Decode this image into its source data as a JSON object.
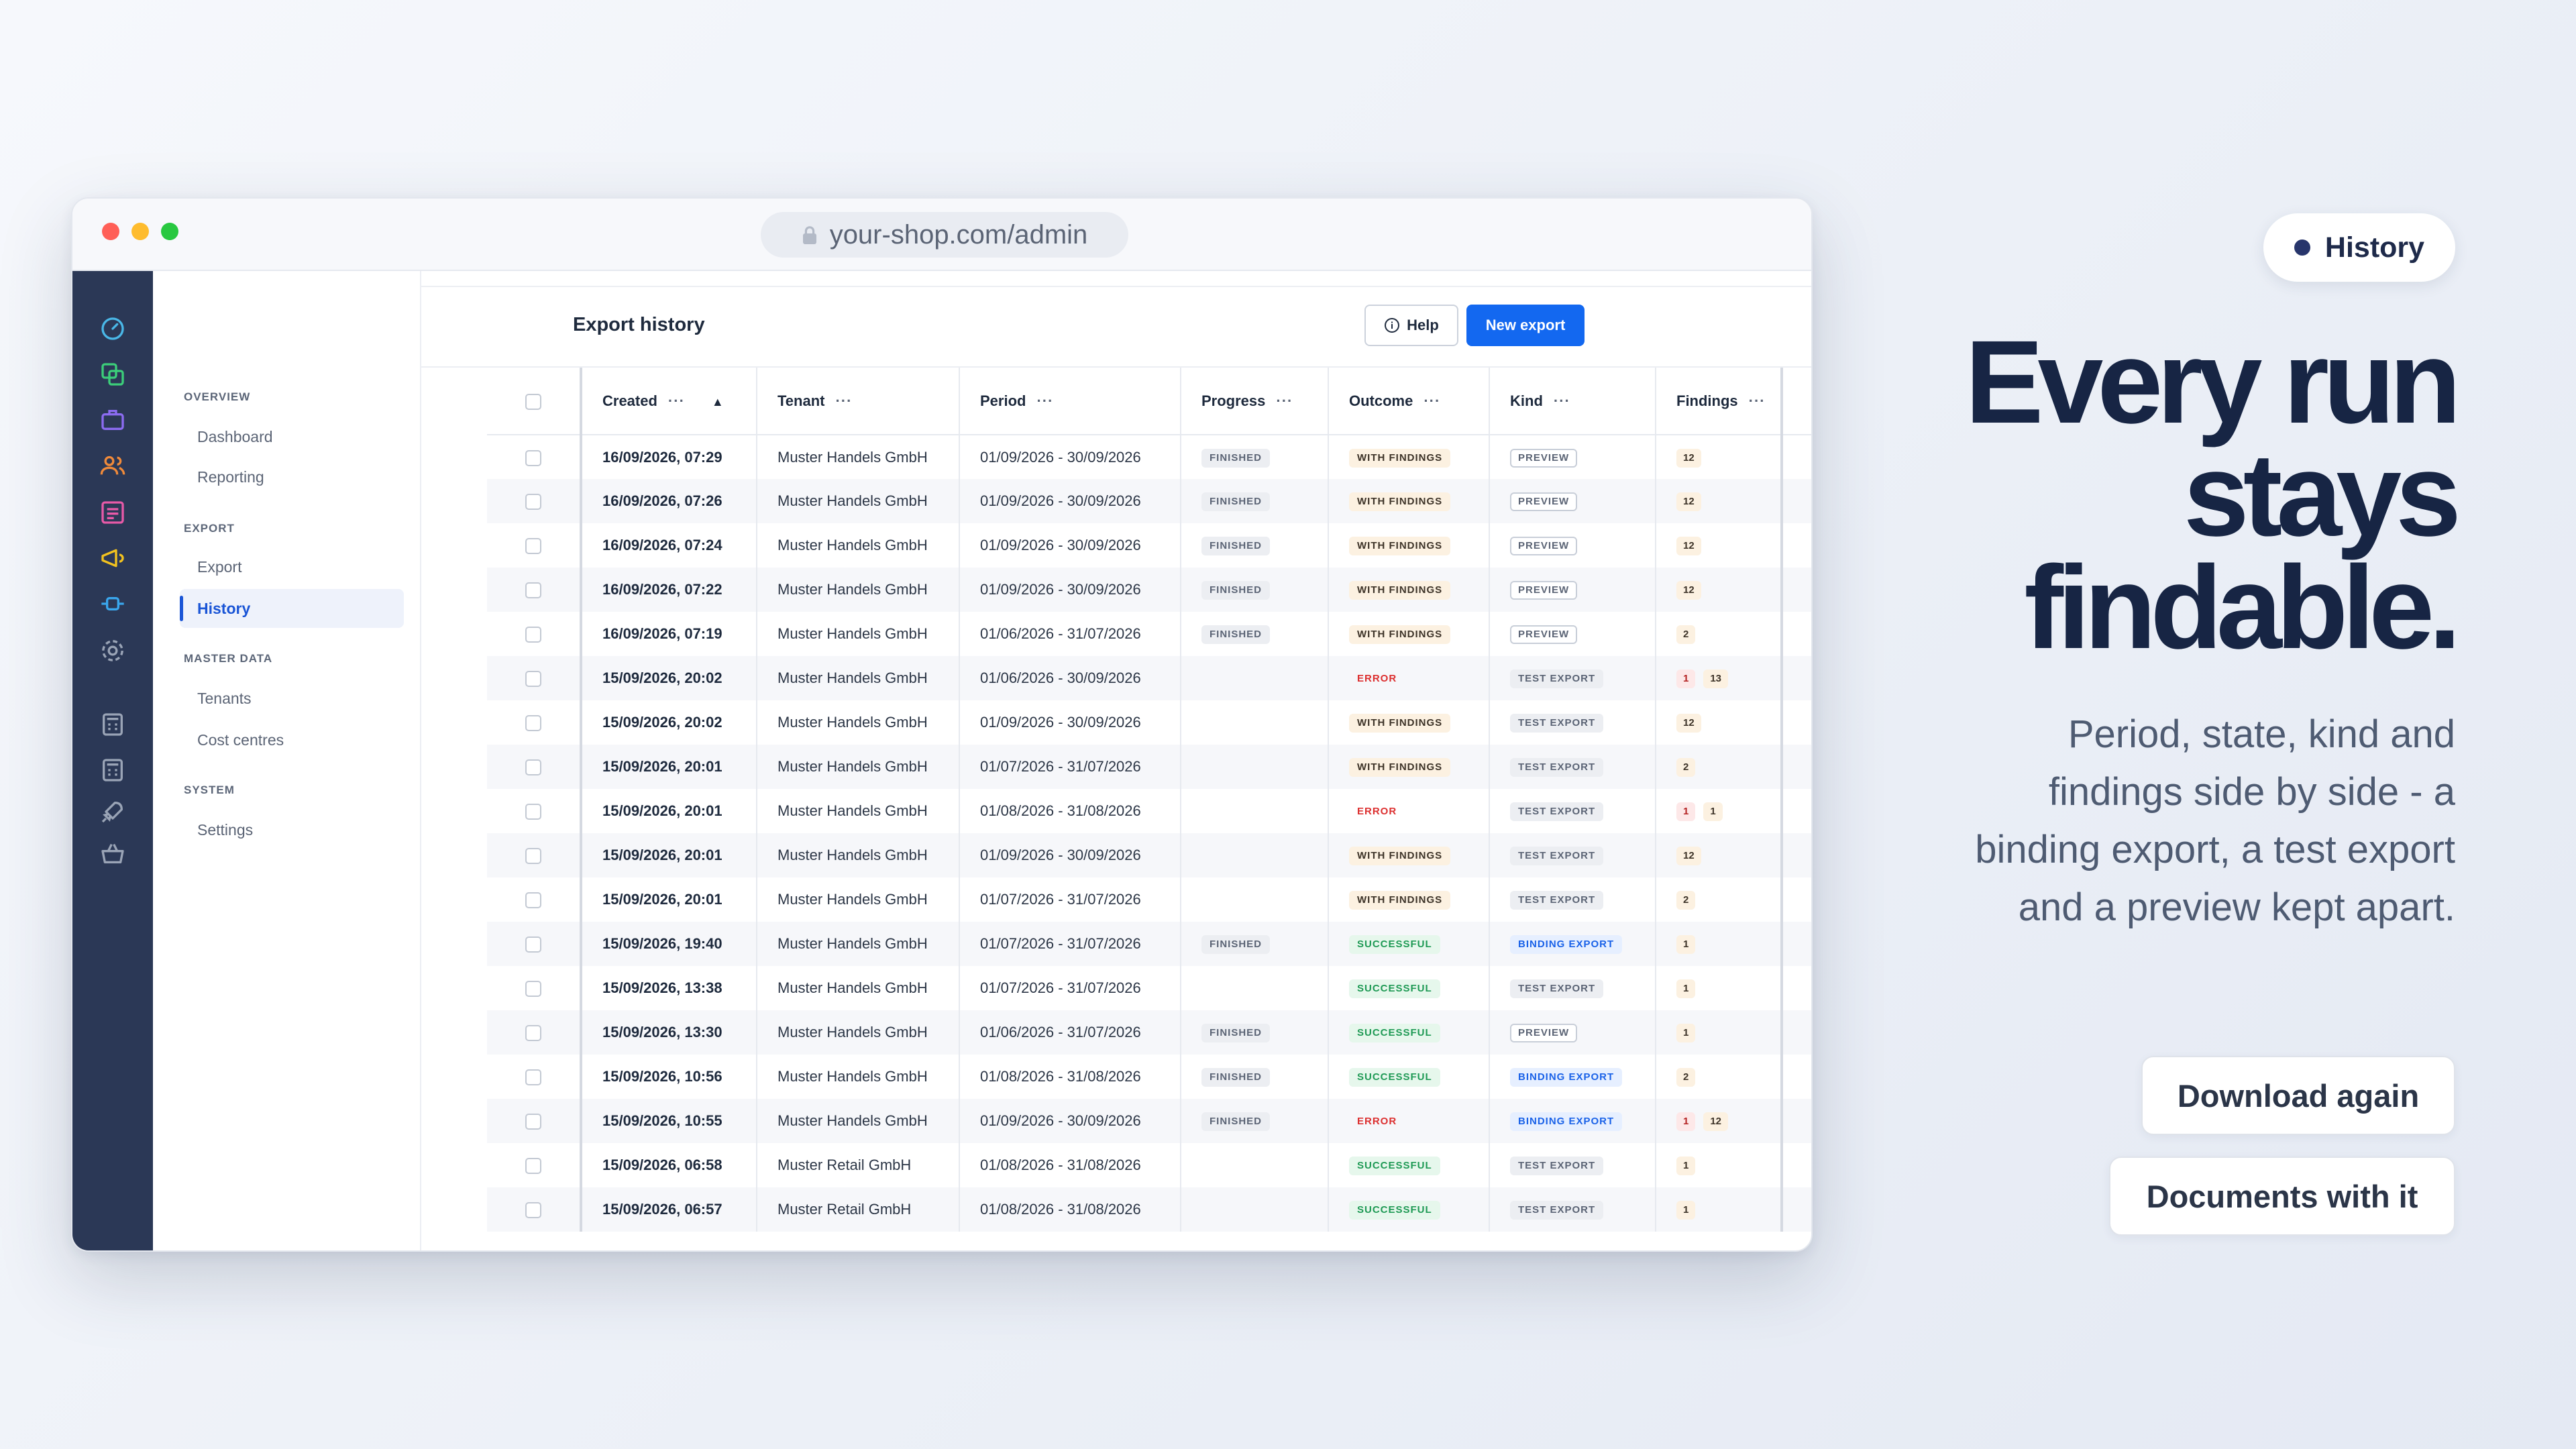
{
  "browser": {
    "url": "your-shop.com/admin"
  },
  "nav": {
    "sections": [
      {
        "title": "OVERVIEW",
        "items": [
          "Dashboard",
          "Reporting"
        ]
      },
      {
        "title": "EXPORT",
        "items": [
          "Export",
          "History"
        ]
      },
      {
        "title": "MASTER DATA",
        "items": [
          "Tenants",
          "Cost centres"
        ]
      },
      {
        "title": "SYSTEM",
        "items": [
          "Settings"
        ]
      }
    ],
    "active_item": "History"
  },
  "rail": {
    "icons": [
      {
        "name": "gauge-icon",
        "color": "#4ab8e8"
      },
      {
        "name": "copy-icon",
        "color": "#3ccf7a"
      },
      {
        "name": "briefcase-icon",
        "color": "#8c6cf2"
      },
      {
        "name": "users-icon",
        "color": "#f08a3a"
      },
      {
        "name": "list-icon",
        "color": "#e85aa8"
      },
      {
        "name": "megaphone-icon",
        "color": "#f2c21f"
      },
      {
        "name": "plug-icon",
        "color": "#3aa7ee"
      },
      {
        "name": "gear-icon",
        "color": "#9aa4b6"
      },
      {
        "name": "calculator-icon",
        "color": "#9aa4b6"
      },
      {
        "name": "calculator-icon",
        "color": "#9aa4b6"
      },
      {
        "name": "rocket-icon",
        "color": "#9aa4b6"
      },
      {
        "name": "basket-icon",
        "color": "#9aa4b6"
      }
    ]
  },
  "header": {
    "title": "Export history",
    "help_label": "Help",
    "new_export_label": "New export"
  },
  "table": {
    "columns": [
      "Created",
      "Tenant",
      "Period",
      "Progress",
      "Outcome",
      "Kind",
      "Findings"
    ],
    "col_menu": "···",
    "sort_indicator": "▲",
    "row_menu": "···",
    "rows": [
      {
        "created": "16/09/2026, 07:29",
        "tenant": "Muster Handels GmbH",
        "period": "01/09/2026 - 30/09/2026",
        "progress": "FINISHED",
        "outcome": "WITH FINDINGS",
        "kind": "PREVIEW",
        "findings": [
          {
            "v": "12",
            "t": "warn"
          }
        ]
      },
      {
        "created": "16/09/2026, 07:26",
        "tenant": "Muster Handels GmbH",
        "period": "01/09/2026 - 30/09/2026",
        "progress": "FINISHED",
        "outcome": "WITH FINDINGS",
        "kind": "PREVIEW",
        "findings": [
          {
            "v": "12",
            "t": "warn"
          }
        ]
      },
      {
        "created": "16/09/2026, 07:24",
        "tenant": "Muster Handels GmbH",
        "period": "01/09/2026 - 30/09/2026",
        "progress": "FINISHED",
        "outcome": "WITH FINDINGS",
        "kind": "PREVIEW",
        "findings": [
          {
            "v": "12",
            "t": "warn"
          }
        ]
      },
      {
        "created": "16/09/2026, 07:22",
        "tenant": "Muster Handels GmbH",
        "period": "01/09/2026 - 30/09/2026",
        "progress": "FINISHED",
        "outcome": "WITH FINDINGS",
        "kind": "PREVIEW",
        "findings": [
          {
            "v": "12",
            "t": "warn"
          }
        ]
      },
      {
        "created": "16/09/2026, 07:19",
        "tenant": "Muster Handels GmbH",
        "period": "01/06/2026 - 31/07/2026",
        "progress": "FINISHED",
        "outcome": "WITH FINDINGS",
        "kind": "PREVIEW",
        "findings": [
          {
            "v": "2",
            "t": "warn"
          }
        ]
      },
      {
        "created": "15/09/2026, 20:02",
        "tenant": "Muster Handels GmbH",
        "period": "01/06/2026 - 30/09/2026",
        "progress": "",
        "outcome": "ERROR",
        "kind": "TEST EXPORT",
        "findings": [
          {
            "v": "1",
            "t": "err"
          },
          {
            "v": "13",
            "t": "warn"
          }
        ]
      },
      {
        "created": "15/09/2026, 20:02",
        "tenant": "Muster Handels GmbH",
        "period": "01/09/2026 - 30/09/2026",
        "progress": "",
        "outcome": "WITH FINDINGS",
        "kind": "TEST EXPORT",
        "findings": [
          {
            "v": "12",
            "t": "warn"
          }
        ]
      },
      {
        "created": "15/09/2026, 20:01",
        "tenant": "Muster Handels GmbH",
        "period": "01/07/2026 - 31/07/2026",
        "progress": "",
        "outcome": "WITH FINDINGS",
        "kind": "TEST EXPORT",
        "findings": [
          {
            "v": "2",
            "t": "warn"
          }
        ]
      },
      {
        "created": "15/09/2026, 20:01",
        "tenant": "Muster Handels GmbH",
        "period": "01/08/2026 - 31/08/2026",
        "progress": "",
        "outcome": "ERROR",
        "kind": "TEST EXPORT",
        "findings": [
          {
            "v": "1",
            "t": "err"
          },
          {
            "v": "1",
            "t": "warn"
          }
        ]
      },
      {
        "created": "15/09/2026, 20:01",
        "tenant": "Muster Handels GmbH",
        "period": "01/09/2026 - 30/09/2026",
        "progress": "",
        "outcome": "WITH FINDINGS",
        "kind": "TEST EXPORT",
        "findings": [
          {
            "v": "12",
            "t": "warn"
          }
        ]
      },
      {
        "created": "15/09/2026, 20:01",
        "tenant": "Muster Handels GmbH",
        "period": "01/07/2026 - 31/07/2026",
        "progress": "",
        "outcome": "WITH FINDINGS",
        "kind": "TEST EXPORT",
        "findings": [
          {
            "v": "2",
            "t": "warn"
          }
        ]
      },
      {
        "created": "15/09/2026, 19:40",
        "tenant": "Muster Handels GmbH",
        "period": "01/07/2026 - 31/07/2026",
        "progress": "FINISHED",
        "outcome": "SUCCESSFUL",
        "kind": "BINDING EXPORT",
        "findings": [
          {
            "v": "1",
            "t": "warn"
          }
        ]
      },
      {
        "created": "15/09/2026, 13:38",
        "tenant": "Muster Handels GmbH",
        "period": "01/07/2026 - 31/07/2026",
        "progress": "",
        "outcome": "SUCCESSFUL",
        "kind": "TEST EXPORT",
        "findings": [
          {
            "v": "1",
            "t": "warn"
          }
        ]
      },
      {
        "created": "15/09/2026, 13:30",
        "tenant": "Muster Handels GmbH",
        "period": "01/06/2026 - 31/07/2026",
        "progress": "FINISHED",
        "outcome": "SUCCESSFUL",
        "kind": "PREVIEW",
        "findings": [
          {
            "v": "1",
            "t": "warn"
          }
        ]
      },
      {
        "created": "15/09/2026, 10:56",
        "tenant": "Muster Handels GmbH",
        "period": "01/08/2026 - 31/08/2026",
        "progress": "FINISHED",
        "outcome": "SUCCESSFUL",
        "kind": "BINDING EXPORT",
        "findings": [
          {
            "v": "2",
            "t": "warn"
          }
        ]
      },
      {
        "created": "15/09/2026, 10:55",
        "tenant": "Muster Handels GmbH",
        "period": "01/09/2026 - 30/09/2026",
        "progress": "FINISHED",
        "outcome": "ERROR",
        "kind": "BINDING EXPORT",
        "findings": [
          {
            "v": "1",
            "t": "err"
          },
          {
            "v": "12",
            "t": "warn"
          }
        ]
      },
      {
        "created": "15/09/2026, 06:58",
        "tenant": "Muster Retail GmbH",
        "period": "01/08/2026 - 31/08/2026",
        "progress": "",
        "outcome": "SUCCESSFUL",
        "kind": "TEST EXPORT",
        "findings": [
          {
            "v": "1",
            "t": "warn"
          }
        ]
      },
      {
        "created": "15/09/2026, 06:57",
        "tenant": "Muster Retail GmbH",
        "period": "01/08/2026 - 31/08/2026",
        "progress": "",
        "outcome": "SUCCESSFUL",
        "kind": "TEST EXPORT",
        "findings": [
          {
            "v": "1",
            "t": "warn"
          }
        ]
      }
    ]
  },
  "marketing": {
    "pill_label": "History",
    "headline": [
      "Every run",
      "stays",
      "findable."
    ],
    "subtext": "Period, state, kind and findings side by side - a binding export, a test export and a preview kept apart.",
    "cta_download": "Download again",
    "cta_documents": "Documents with it"
  }
}
